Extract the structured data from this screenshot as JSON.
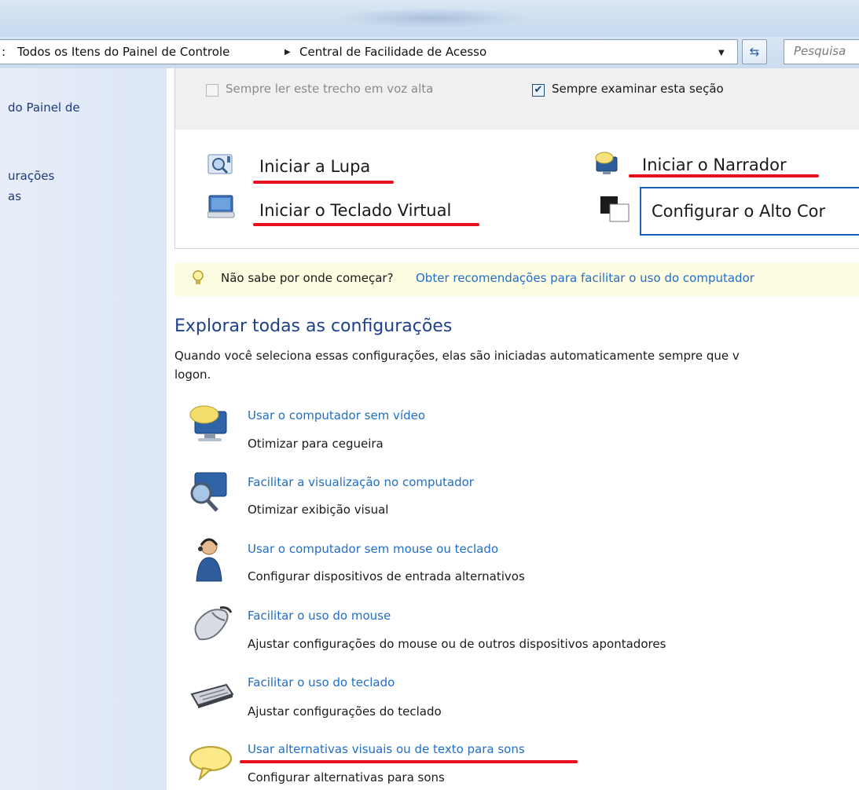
{
  "address": {
    "crumbs": [
      "Todos os Itens do Painel de Controle",
      "Central de Facilidade de Acesso"
    ],
    "search_placeholder": "Pesquisa"
  },
  "left_pane": {
    "links": [
      {
        "line1": "do Painel de"
      },
      {
        "line1": "urações",
        "line2": "as"
      }
    ]
  },
  "quick": {
    "read_aloud_label": "Sempre ler este trecho em voz alta",
    "read_aloud_checked": false,
    "scan_label": "Sempre examinar esta seção",
    "scan_checked": true
  },
  "tools": {
    "magnifier": "Iniciar a Lupa",
    "narrator": "Iniciar o Narrador",
    "keyboard": "Iniciar o Teclado Virtual",
    "contrast": "Configurar o Alto Cor"
  },
  "tip": {
    "question": "Não sabe por onde começar?",
    "link": "Obter recomendações para facilitar o uso do computador"
  },
  "explore": {
    "title": "Explorar todas as configurações",
    "description": "Quando você seleciona essas configurações, elas são iniciadas automaticamente sempre que v logon.",
    "desc_line1": "Quando você seleciona essas configurações, elas são iniciadas automaticamente sempre que v",
    "desc_line2": "logon.",
    "items": [
      {
        "link": "Usar o computador sem vídeo",
        "desc": "Otimizar para cegueira",
        "icon": "monitor-speech-icon"
      },
      {
        "link": "Facilitar a visualização no computador",
        "desc": "Otimizar exibição visual",
        "icon": "magnifier-monitor-icon"
      },
      {
        "link": "Usar o computador sem mouse ou teclado",
        "desc": "Configurar dispositivos de entrada alternativos",
        "icon": "person-headset-icon"
      },
      {
        "link": "Facilitar o uso do mouse",
        "desc": "Ajustar configurações do mouse ou de outros dispositivos apontadores",
        "icon": "mouse-icon"
      },
      {
        "link": "Facilitar o uso do teclado",
        "desc": "Ajustar configurações do teclado",
        "icon": "keyboard-icon"
      },
      {
        "link": "Usar alternativas visuais ou de texto para sons",
        "desc": "Configurar alternativas para sons",
        "icon": "speech-bubble-icon"
      }
    ]
  },
  "colors": {
    "link": "#1f6ec8",
    "heading": "#1e3f8c",
    "highlight_underline": "#e8101e",
    "tip_background": "#fffde1"
  }
}
